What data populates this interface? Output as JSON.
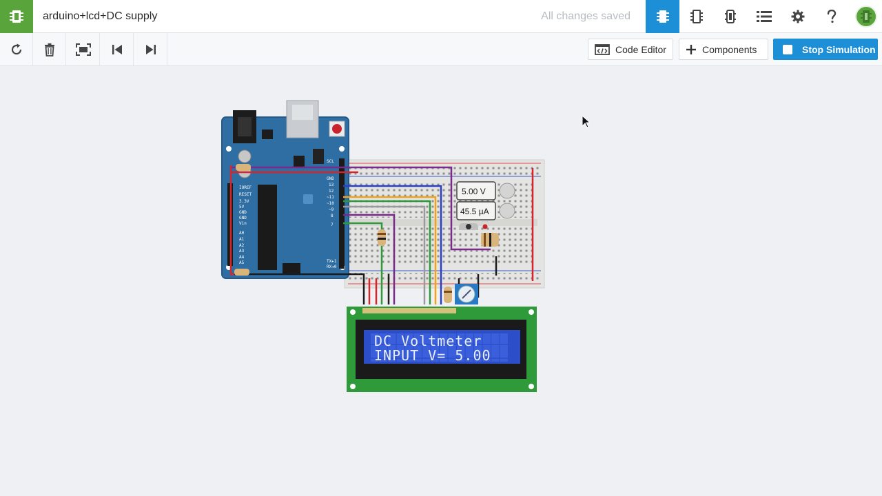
{
  "header": {
    "title": "arduino+lcd+DC supply",
    "save_status": "All changes saved",
    "icons": [
      "circuit-view-icon",
      "components-view-icon",
      "schematic-view-icon",
      "component-list-icon",
      "settings-icon",
      "help-icon",
      "user-avatar-icon"
    ]
  },
  "toolbar": {
    "tools": [
      "rotate-icon",
      "delete-icon",
      "fit-view-icon",
      "step-back-icon",
      "step-forward-icon"
    ],
    "code_editor_label": "Code Editor",
    "components_label": "Components",
    "stop_simulation_label": "Stop Simulation"
  },
  "canvas": {
    "voltmeter_reading": "5.00 V",
    "ammeter_reading": "45.5 µA",
    "lcd_line1": "DC Voltmeter",
    "lcd_line2": "INPUT V= 5.00"
  },
  "colors": {
    "brand_green": "#5aa43c",
    "accent_blue": "#1d8fd6",
    "arduino_blue": "#2f6ea3",
    "lcd_green": "#2f9a3a",
    "lcd_screen": "#2c4fc9"
  }
}
